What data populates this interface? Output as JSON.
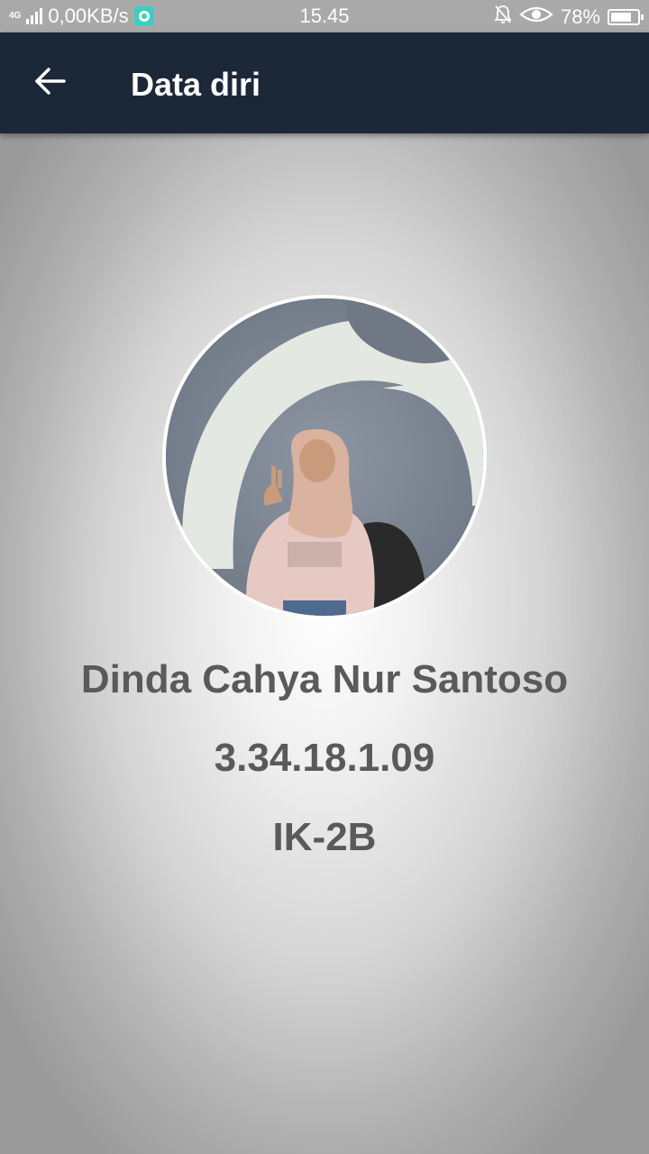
{
  "status_bar": {
    "network_type": "4G",
    "data_speed": "0,00KB/s",
    "time": "15.45",
    "battery_percent": "78%",
    "battery_level": 0.78,
    "icons": [
      "signal-icon",
      "app-notification-icon",
      "mute-bell-icon",
      "eye-icon",
      "battery-icon"
    ]
  },
  "app_bar": {
    "title": "Data diri",
    "back_icon": "arrow-left-icon",
    "background": "#1c2838"
  },
  "profile": {
    "name": "Dinda Cahya Nur Santoso",
    "student_id": "3.34.18.1.09",
    "class": "IK-2B",
    "text_color": "#5a5a5a"
  }
}
